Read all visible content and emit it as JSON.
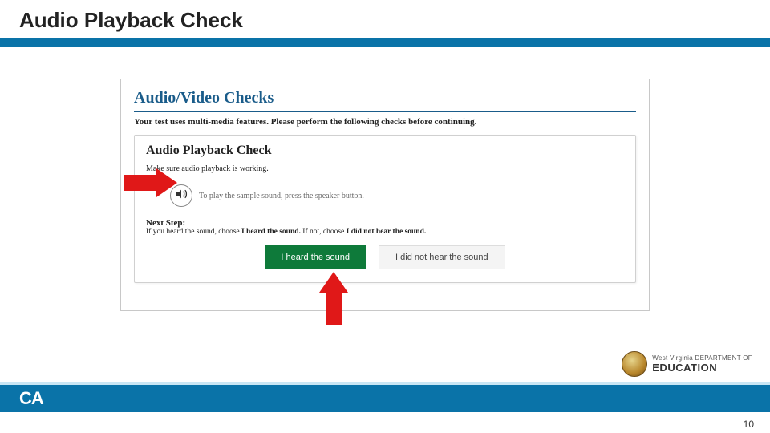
{
  "slide": {
    "title": "Audio Playback Check",
    "page_number": "10"
  },
  "panel": {
    "heading": "Audio/Video Checks",
    "subtext": "Your test uses multi-media features. Please perform the following checks before continuing."
  },
  "card": {
    "title": "Audio Playback Check",
    "desc": "Make sure audio playback is working.",
    "play_caption": "To play the sample sound, press the speaker button.",
    "next_step_label": "Next Step:",
    "next_step_prefix": "If you heard the sound, choose ",
    "next_step_bold1": "I heard the sound.",
    "next_step_mid": " If not, choose ",
    "next_step_bold2": "I did not hear the sound.",
    "btn_heard": "I heard the sound",
    "btn_not_heard": "I did not hear the sound"
  },
  "brand": {
    "ca": "CA",
    "wv_line1": "West Virginia DEPARTMENT OF",
    "wv_line2": "EDUCATION"
  }
}
